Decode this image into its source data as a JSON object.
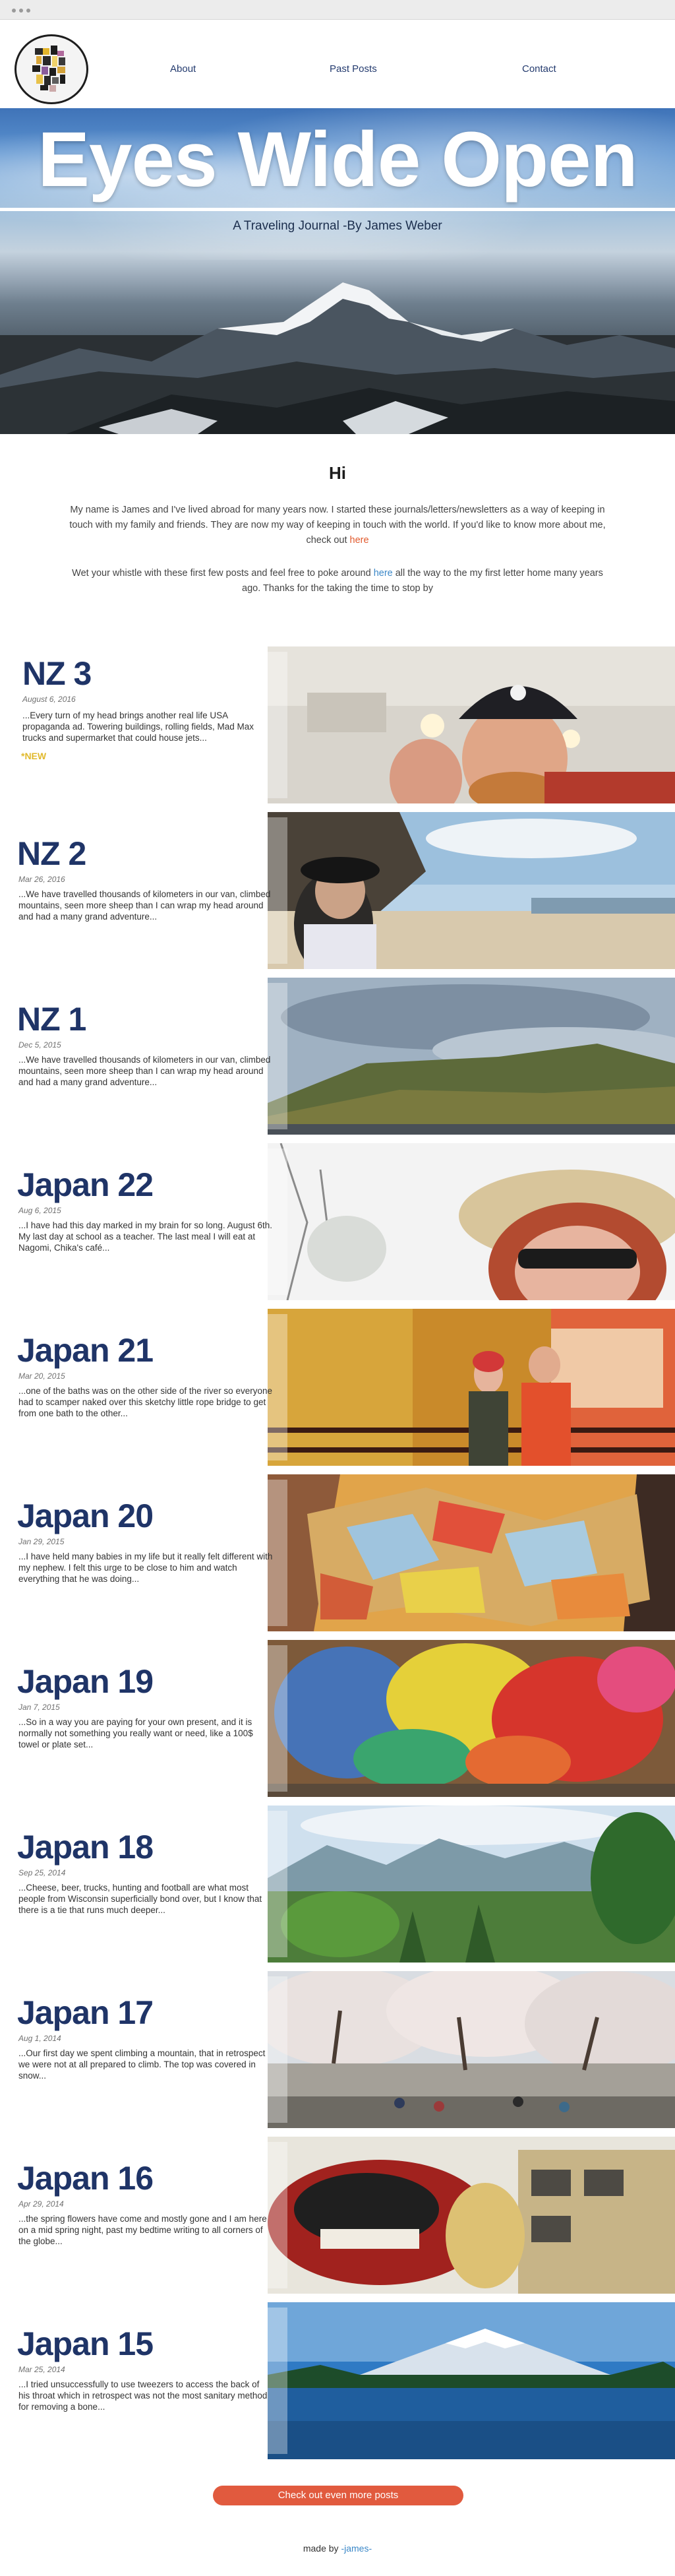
{
  "nav": {
    "about": "About",
    "past_posts": "Past Posts",
    "contact": "Contact"
  },
  "hero": {
    "title": "Eyes Wide Open",
    "tagline": "A Traveling Journal -By James Weber"
  },
  "intro": {
    "heading": "Hi",
    "p1_text": "My name is James and I've lived abroad for many years now. I started these journals/letters/newsletters as a way of keeping in touch with my family and friends. They are now my way of keeping in touch with the world. If you'd like to know more about me, check out ",
    "p1_link": "here",
    "p2_before": "Wet your whistle with these first few posts and feel free to poke around ",
    "p2_link": "here",
    "p2_after": " all the way to the my first letter home many years ago. Thanks for the taking the time to stop by"
  },
  "posts": [
    {
      "title": "NZ 3",
      "date": "August 6, 2016",
      "excerpt": "...Every turn of my head brings another real life USA propaganda ad. Towering buildings, rolling fields, Mad Max trucks and supermarket that could house jets...",
      "badge": "*NEW"
    },
    {
      "title": "NZ 2",
      "date": "Mar 26, 2016",
      "excerpt": "...We have travelled thousands of kilometers in our van, climbed mountains, seen more sheep than I can wrap my head around and had a many grand adventure..."
    },
    {
      "title": "NZ 1",
      "date": "Dec 5, 2015",
      "excerpt": "...We have travelled thousands of kilometers in our van, climbed mountains, seen more sheep than I can wrap my head around and had a many grand adventure..."
    },
    {
      "title": "Japan 22",
      "date": "Aug 6, 2015",
      "excerpt": "...I have had this day marked in my brain for so long. August 6th. My last day at school as a teacher. The last meal I will eat at Nagomi, Chika's café..."
    },
    {
      "title": "Japan 21",
      "date": "Mar 20, 2015",
      "excerpt": "...one of the baths was on the other side of the river so everyone had to scamper naked over this sketchy little rope bridge to get from one bath to the other..."
    },
    {
      "title": "Japan 20",
      "date": "Jan 29, 2015",
      "excerpt": "...I have held many babies in my life but it really felt different with my nephew. I felt this urge to be close to him and watch everything that he was doing..."
    },
    {
      "title": "Japan 19",
      "date": "Jan 7, 2015",
      "excerpt": "...So in a way you are paying for your own present, and it is normally not something you really want or need, like a 100$ towel or plate set..."
    },
    {
      "title": "Japan 18",
      "date": "Sep 25, 2014",
      "excerpt": "...Cheese, beer, trucks, hunting and football are what most people from Wisconsin superficially bond over, but I know that there is a tie that runs much deeper..."
    },
    {
      "title": "Japan 17",
      "date": "Aug 1, 2014",
      "excerpt": "...Our first day we spent climbing a mountain, that in retrospect we were not at all prepared to climb. The top was covered in snow..."
    },
    {
      "title": "Japan 16",
      "date": "Apr 29, 2014",
      "excerpt": "...the spring flowers have come and mostly gone and I am here on a mid spring night, past my bedtime writing to all corners of the globe..."
    },
    {
      "title": "Japan 15",
      "date": "Mar 25, 2014",
      "excerpt": "...I tried unsuccessfully to use tweezers to access the back of his throat which in retrospect was not the most sanitary method for removing a bone..."
    }
  ],
  "more_button": "Check out even more posts",
  "footer": {
    "made_by": "made by ",
    "signature": "-james-"
  },
  "colors": {
    "title_blue": "#1f3467",
    "accent_red": "#e15a3e",
    "link_blue": "#3c88c8",
    "new_yellow": "#e1b92d"
  }
}
